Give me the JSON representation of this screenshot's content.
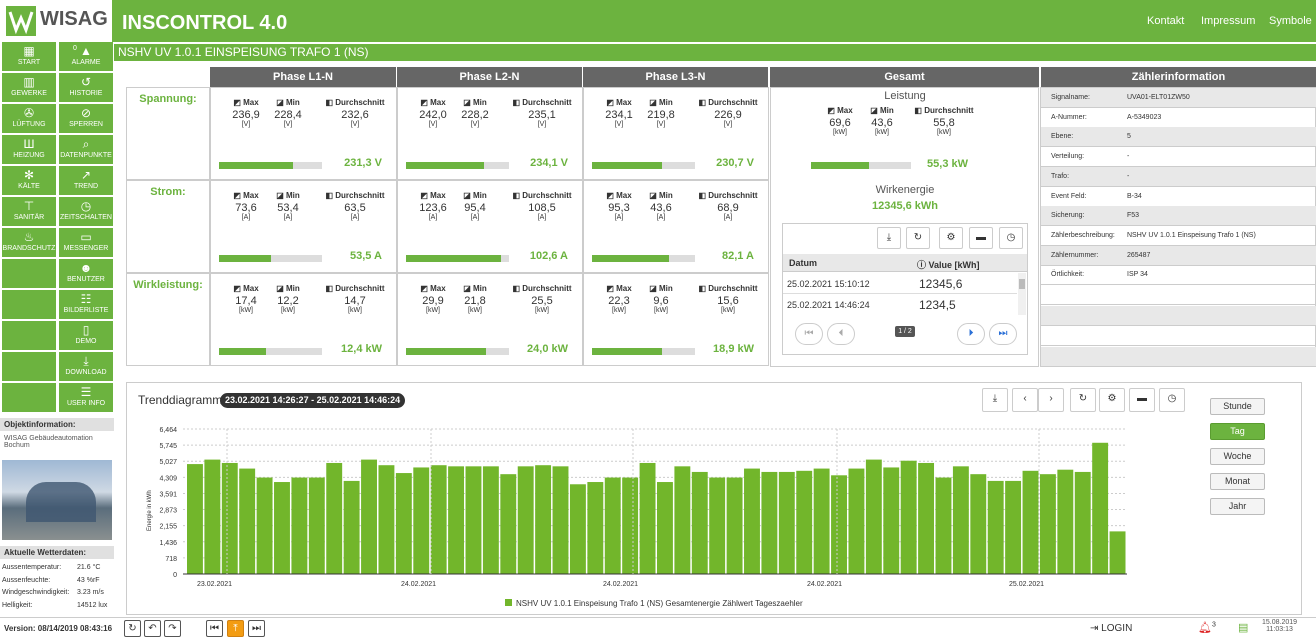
{
  "app": {
    "logo": "WISAG",
    "title": "INSCONTROL 4.0"
  },
  "toplinks": [
    "Kontakt",
    "Impressum",
    "Symbole"
  ],
  "nav": [
    {
      "label": "START",
      "icon": "grid-icon",
      "glyph": "▦"
    },
    {
      "label": "ALARME",
      "icon": "alarm-icon",
      "glyph": "▲",
      "badge": "0"
    },
    {
      "label": "GEWERKE",
      "icon": "building-icon",
      "glyph": "▥"
    },
    {
      "label": "HISTORIE",
      "icon": "history-icon",
      "glyph": "↺"
    },
    {
      "label": "LÜFTUNG",
      "icon": "fan-icon",
      "glyph": "✇"
    },
    {
      "label": "SPERREN",
      "icon": "lock-icon",
      "glyph": "⊘"
    },
    {
      "label": "HEIZUNG",
      "icon": "heater-icon",
      "glyph": "Ш"
    },
    {
      "label": "DATENPUNKTE",
      "icon": "search-icon",
      "glyph": "⌕"
    },
    {
      "label": "KÄLTE",
      "icon": "snow-icon",
      "glyph": "✻"
    },
    {
      "label": "TREND",
      "icon": "trend-icon",
      "glyph": "↗"
    },
    {
      "label": "SANITÄR",
      "icon": "tap-icon",
      "glyph": "⊤"
    },
    {
      "label": "ZEITSCHALTEN",
      "icon": "clock-icon",
      "glyph": "◷"
    },
    {
      "label": "BRANDSCHUTZ",
      "icon": "flame-icon",
      "glyph": "♨"
    },
    {
      "label": "MESSENGER",
      "icon": "message-icon",
      "glyph": "▭"
    },
    {
      "label": "",
      "icon": "",
      "glyph": ""
    },
    {
      "label": "BENUTZER",
      "icon": "user-icon",
      "glyph": "☻"
    },
    {
      "label": "",
      "icon": "",
      "glyph": ""
    },
    {
      "label": "BILDERLISTE",
      "icon": "sitemap-icon",
      "glyph": "☷"
    },
    {
      "label": "",
      "icon": "",
      "glyph": ""
    },
    {
      "label": "DEMO",
      "icon": "door-icon",
      "glyph": "▯"
    },
    {
      "label": "",
      "icon": "",
      "glyph": ""
    },
    {
      "label": "DOWNLOAD",
      "icon": "download-icon",
      "glyph": "⤓"
    },
    {
      "label": "",
      "icon": "",
      "glyph": ""
    },
    {
      "label": "USER INFO",
      "icon": "info-icon",
      "glyph": "☰"
    }
  ],
  "breadcrumb": "NSHV UV 1.0.1 EINSPEISUNG TRAFO 1 (NS)",
  "columns": [
    "Phase L1-N",
    "Phase L2-N",
    "Phase L3-N",
    "Gesamt",
    "Zählerinformation"
  ],
  "stat_heads": {
    "max": "Max",
    "min": "Min",
    "avg": "Durchschnitt"
  },
  "rows": [
    {
      "label": "Spannung:",
      "phases": [
        {
          "max": "236,9",
          "min": "228,4",
          "avg": "232,6",
          "unit": "[V]",
          "current": "231,3 V",
          "fill": 0.72
        },
        {
          "max": "242,0",
          "min": "228,2",
          "avg": "235,1",
          "unit": "[V]",
          "current": "234,1 V",
          "fill": 0.76
        },
        {
          "max": "234,1",
          "min": "219,8",
          "avg": "226,9",
          "unit": "[V]",
          "current": "230,7 V",
          "fill": 0.68
        }
      ]
    },
    {
      "label": "Strom:",
      "phases": [
        {
          "max": "73,6",
          "min": "53,4",
          "avg": "63,5",
          "unit": "[A]",
          "current": "53,5 A",
          "fill": 0.5
        },
        {
          "max": "123,6",
          "min": "95,4",
          "avg": "108,5",
          "unit": "[A]",
          "current": "102,6 A",
          "fill": 0.92
        },
        {
          "max": "95,3",
          "min": "43,6",
          "avg": "68,9",
          "unit": "[A]",
          "current": "82,1 A",
          "fill": 0.75
        }
      ]
    },
    {
      "label": "Wirkleistung:",
      "phases": [
        {
          "max": "17,4",
          "min": "12,2",
          "avg": "14,7",
          "unit": "[kW]",
          "current": "12,4 kW",
          "fill": 0.46
        },
        {
          "max": "29,9",
          "min": "21,8",
          "avg": "25,5",
          "unit": "[kW]",
          "current": "24,0 kW",
          "fill": 0.78
        },
        {
          "max": "22,3",
          "min": "9,6",
          "avg": "15,6",
          "unit": "[kW]",
          "current": "18,9 kW",
          "fill": 0.68
        }
      ]
    }
  ],
  "gesamt": {
    "leistung_title": "Leistung",
    "max": "69,6",
    "min": "43,6",
    "avg": "55,8",
    "unit": "[kW]",
    "current": "55,3 kW",
    "fill": 0.58,
    "wirkenergie_title": "Wirkenergie",
    "wirkenergie_value": "12345,6 kWh",
    "table_head": {
      "datum": "Datum",
      "value": "Value [kWh]"
    },
    "table_rows": [
      {
        "datum": "25.02.2021 15:10:12",
        "value": "12345,6"
      },
      {
        "datum": "25.02.2021 14:46:24",
        "value": "1234,5"
      }
    ],
    "page": "1 / 2"
  },
  "zinfo": [
    {
      "k": "Signalname:",
      "v": "UVA01-ELT01ZW50"
    },
    {
      "k": "A-Nummer:",
      "v": "A-5349023"
    },
    {
      "k": "Ebene:",
      "v": "5"
    },
    {
      "k": "Verteilung:",
      "v": "-"
    },
    {
      "k": "Trafo:",
      "v": "-"
    },
    {
      "k": "Event Feld:",
      "v": "B-34"
    },
    {
      "k": "Sicherung:",
      "v": "F53"
    },
    {
      "k": "Zählerbeschreibung:",
      "v": "NSHV UV 1.0.1 Einspeisung Trafo 1 (NS)"
    },
    {
      "k": "Zählernummer:",
      "v": "265487"
    },
    {
      "k": "Örtlichkeit:",
      "v": "ISP 34"
    }
  ],
  "trend": {
    "title": "Trenddiagramm",
    "range": "23.02.2021 14:26:27 - 25.02.2021 14:46:24"
  },
  "ranges": [
    "Stunde",
    "Tag",
    "Woche",
    "Monat",
    "Jahr"
  ],
  "range_selected": "Tag",
  "objinfo": {
    "title": "Objektinformation:",
    "text": "WISAG Gebäudeautomation Bochum"
  },
  "weather": {
    "title": "Aktuelle Wetterdaten:",
    "rows": [
      {
        "k": "Aussentemperatur:",
        "v": "21.6 °C"
      },
      {
        "k": "Aussenfeuchte:",
        "v": "43 %rF"
      },
      {
        "k": "Windgeschwindigkeit:",
        "v": "3.23 m/s"
      },
      {
        "k": "Helligkeit:",
        "v": "14512 lux"
      }
    ]
  },
  "footer": {
    "version": "Version: 08/14/2019 08:43:16",
    "login": "LOGIN",
    "alarm_count": "3",
    "date": "15.08.2019",
    "time": "11:03:13"
  },
  "chart_data": {
    "type": "bar",
    "ylabel": "Energie in kWh",
    "yticks": [
      "0",
      "718",
      "1,436",
      "2,155",
      "2,873",
      "3,591",
      "4,309",
      "5,027",
      "5,745",
      "6,464"
    ],
    "ylim": [
      0,
      6464
    ],
    "xticks": [
      "23.02.2021",
      "24.02.2021",
      "24.02.2021",
      "24.02.2021",
      "25.02.2021"
    ],
    "legend": "NSHV UV 1.0.1 Einspeisung Trafo 1 (NS) Gesamtenergie Zählwert Tageszaehler",
    "values": [
      4900,
      5100,
      4950,
      4700,
      4300,
      4100,
      4300,
      4300,
      4950,
      4150,
      5100,
      4850,
      4500,
      4750,
      4850,
      4800,
      4800,
      4800,
      4450,
      4800,
      4850,
      4800,
      4000,
      4100,
      4300,
      4300,
      4950,
      4100,
      4800,
      4550,
      4300,
      4300,
      4700,
      4550,
      4550,
      4600,
      4700,
      4400,
      4700,
      5100,
      4750,
      5050,
      4950,
      4300,
      4800,
      4450,
      4150,
      4150,
      4600,
      4450,
      4650,
      4550,
      5850,
      1900
    ],
    "color": "#72b62b"
  }
}
